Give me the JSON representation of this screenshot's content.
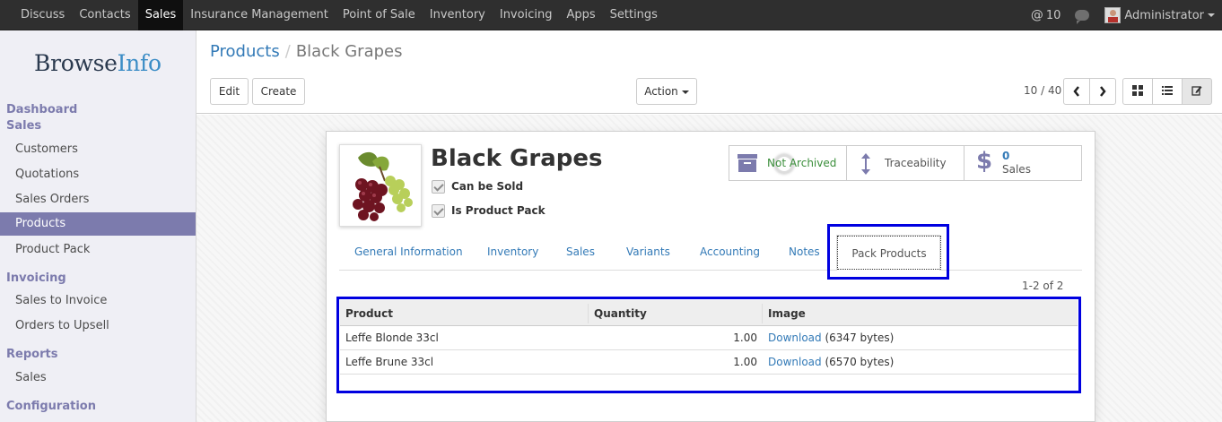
{
  "topbar": {
    "menu": [
      "Discuss",
      "Contacts",
      "Sales",
      "Insurance Management",
      "Point of Sale",
      "Inventory",
      "Invoicing",
      "Apps",
      "Settings"
    ],
    "active_menu": "Sales",
    "notif_count": "10",
    "user": "Administrator"
  },
  "sidebar": {
    "logo_part1": "Browse",
    "logo_part2": "Info",
    "sections": {
      "dashboard": "Dashboard",
      "sales": "Sales",
      "invoicing": "Invoicing",
      "reports": "Reports",
      "configuration": "Configuration"
    },
    "items": {
      "customers": "Customers",
      "quotations": "Quotations",
      "sales_orders": "Sales Orders",
      "products": "Products",
      "product_pack": "Product Pack",
      "sales_to_invoice": "Sales to Invoice",
      "orders_to_upsell": "Orders to Upsell",
      "report_sales": "Sales"
    },
    "active_item": "Products"
  },
  "control_panel": {
    "breadcrumb_parent": "Products",
    "breadcrumb_current": "Black Grapes",
    "edit_label": "Edit",
    "create_label": "Create",
    "action_label": "Action",
    "pager": "10 / 40"
  },
  "form": {
    "product_name": "Black Grapes",
    "can_be_sold_label": "Can be Sold",
    "is_pack_label": "Is Product Pack",
    "smart_buttons": {
      "archived": "Not Archived",
      "traceability": "Traceability",
      "sales_count": "0",
      "sales_label": "Sales"
    },
    "tabs": [
      "General Information",
      "Inventory",
      "Sales",
      "Variants",
      "Accounting",
      "Notes",
      "Pack Products"
    ],
    "active_tab": "Pack Products",
    "record_count": "1-2 of 2",
    "table": {
      "headers": [
        "Product",
        "Quantity",
        "Image"
      ],
      "rows": [
        {
          "product": "Leffe Blonde 33cl",
          "quantity": "1.00",
          "image_link": "Download",
          "image_size": "(6347 bytes)"
        },
        {
          "product": "Leffe Brune 33cl",
          "quantity": "1.00",
          "image_link": "Download",
          "image_size": "(6570 bytes)"
        }
      ]
    }
  },
  "colors": {
    "topbar": "#2f2f2f",
    "sidebar_accent": "#7c7bad",
    "link": "#337ab7",
    "highlight_box": "#0000e0",
    "archived_green": "#3a8e3a"
  }
}
